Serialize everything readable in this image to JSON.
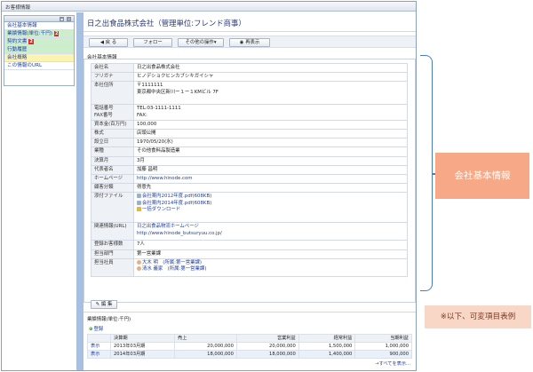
{
  "window": {
    "title": "お客様情報"
  },
  "sidebar": {
    "items": [
      {
        "label": "会社基本情報",
        "style": "white",
        "badge": ""
      },
      {
        "label": "業績情報(単位:千円)",
        "style": "green",
        "badge": "2"
      },
      {
        "label": "契約文書",
        "style": "green",
        "badge": "2"
      },
      {
        "label": "行動履歴",
        "style": "green",
        "badge": ""
      },
      {
        "label": "会社概略",
        "style": "yellow",
        "badge": ""
      },
      {
        "label": "この情報のURL",
        "style": "white",
        "badge": ""
      }
    ]
  },
  "main": {
    "company_title": "日之出食品株式会社（管理単位:フレンド商事）",
    "toolbar": {
      "back": "◀ 戻 る",
      "follow": "フォロー",
      "other": "その他の操作▾",
      "refresh": "再表示"
    },
    "section_label": "会社基本情報",
    "edit_label": "✎ 編 集"
  },
  "info": {
    "company_name": {
      "k": "会社名",
      "v": "日之出食品株式会社"
    },
    "furigana": {
      "k": "フリガナ",
      "v": "ヒノデショクヒンカブシキガイシャ"
    },
    "address": {
      "k": "本社住所",
      "v1": "〒1111111",
      "v2": "東京都中央区新川ー１ー１KMビル 7F"
    },
    "phone": {
      "k1": "電話番号",
      "k2": "FAX番号",
      "v1": "TEL:03-1111-1111",
      "v2": "FAX:"
    },
    "capital": {
      "k": "資本金(百万円)",
      "v": "100,000"
    },
    "stock": {
      "k": "株式",
      "v": "店頭公開"
    },
    "founded": {
      "k": "設立日",
      "v": "1970/05/20(水)"
    },
    "industry": {
      "k": "業種",
      "v": "その他食料品製造業"
    },
    "fiscal": {
      "k": "決算月",
      "v": "3月"
    },
    "rep": {
      "k": "代表者名",
      "v": "加藤 昌明"
    },
    "homepage": {
      "k": "ホームページ",
      "v": "http://www.hinode.com"
    },
    "category": {
      "k": "顧客分類",
      "v": "得意先"
    },
    "attachments": {
      "k": "添付ファイル",
      "f1": "会社案内2012年度.pdf(608KB)",
      "f2": "会社案内2014年度.pdf(608KB)",
      "dl": "一括ダウンロード"
    },
    "related": {
      "k": "関連情報(URL)",
      "v1": "日之出食品物流ホームページ",
      "v2": "http://www.hinode_butsuryuu.co.jp/"
    },
    "customers": {
      "k": "登録お客様数",
      "v": "7人"
    },
    "dept": {
      "k": "担当部門",
      "v": "第一営業課"
    },
    "staff": {
      "k": "担当社員",
      "v1": "大木 明　(所属:第一営業課)",
      "v2": "清水 義家　(所属:第一営業課)"
    }
  },
  "business": {
    "label": "業績情報(単位:千円)",
    "add": "登録",
    "headers": [
      "",
      "決算期",
      "売上",
      "営業利益",
      "経常利益",
      "当期利益"
    ],
    "rows": [
      {
        "link": "表示",
        "period": "2013年03月期",
        "sales": "20,000,000",
        "op": "20,000,000",
        "ord": "1,500,000",
        "net": "1,000,000"
      },
      {
        "link": "表示",
        "period": "2014年03月期",
        "sales": "18,000,000",
        "op": "18,000,000",
        "ord": "1,400,000",
        "net": "900,000"
      }
    ],
    "more": "→すべてを表示..."
  },
  "annotations": {
    "basic": "会社基本情報",
    "note": "※以下、可変項目表例"
  },
  "colors": {
    "accent": "#1f3fa6",
    "strip": "#a7bfe0",
    "annot": "#f7a887",
    "badge": "#d92e2e"
  }
}
